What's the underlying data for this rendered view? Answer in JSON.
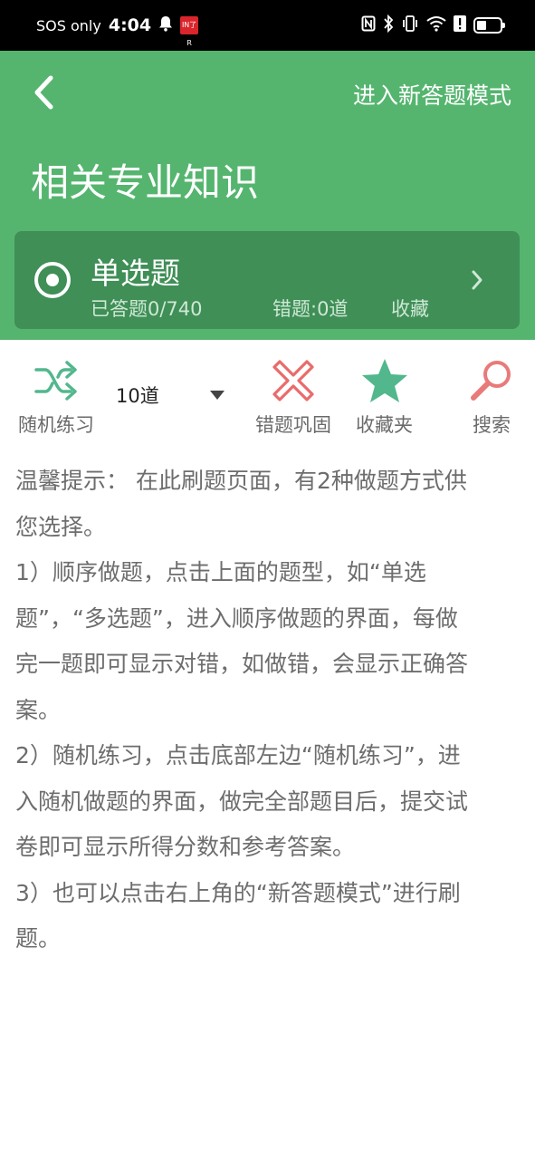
{
  "status_bar": {
    "carrier": "SOS only",
    "time": "4:04",
    "app_badge": "IN了R",
    "icons": [
      "bell-icon",
      "nfc-icon",
      "bluetooth-icon",
      "vibrate-icon",
      "wifi-icon",
      "alert-icon",
      "battery-icon"
    ]
  },
  "header": {
    "new_mode_label": "进入新答题模式",
    "title": "相关专业知识",
    "background_color": "#55b56f"
  },
  "question_card": {
    "title": "单选题",
    "answered": "已答题0/740",
    "wrong": "错题:0道",
    "favorites": "收藏",
    "background_color": "#3f8f57"
  },
  "toolbar": {
    "random": {
      "label": "随机练习",
      "icon": "shuffle-icon"
    },
    "count": {
      "value": "10道"
    },
    "wrong_review": {
      "label": "错题巩固",
      "icon": "x-icon"
    },
    "favorites": {
      "label": "收藏夹",
      "icon": "star-icon"
    },
    "search": {
      "label": "搜索",
      "icon": "search-icon"
    }
  },
  "tips": {
    "lines": [
      "温馨提示：  在此刷题页面，有2种做题方式供",
      "您选择。",
      " 1）顺序做题，点击上面的题型，如“单选",
      "题”，“多选题”，进入顺序做题的界面，每做",
      "完一题即可显示对错，如做错，会显示正确答",
      "案。",
      " 2）随机练习，点击底部左边“随机练习”，进",
      "入随机做题的界面，做完全部题目后，提交试",
      "卷即可显示所得分数和参考答案。",
      " 3）也可以点击右上角的“新答题模式”进行刷",
      "题。"
    ]
  }
}
